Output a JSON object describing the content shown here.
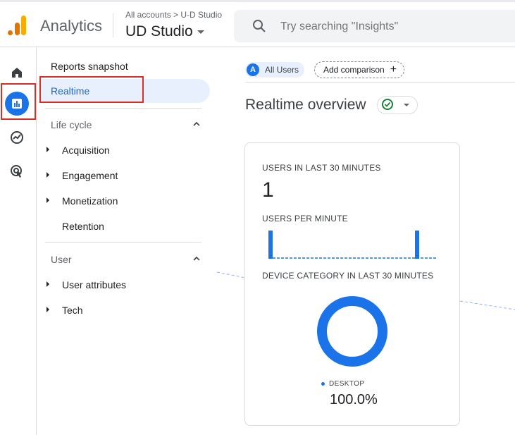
{
  "header": {
    "app_name": "Analytics",
    "breadcrumb": "All accounts > U-D Studio",
    "property_name": "UD Studio",
    "search_placeholder": "Try searching \"Insights\""
  },
  "rail": {
    "icons": [
      "home-icon",
      "reports-icon",
      "explore-icon",
      "advertising-icon"
    ],
    "active": "reports-icon"
  },
  "nav": {
    "reports_snapshot": "Reports snapshot",
    "realtime": "Realtime",
    "lifecycle": {
      "label": "Life cycle",
      "items": [
        "Acquisition",
        "Engagement",
        "Monetization",
        "Retention"
      ]
    },
    "user": {
      "label": "User",
      "items": [
        "User attributes",
        "Tech"
      ]
    }
  },
  "main": {
    "comparison_chip": {
      "avatar": "A",
      "label": "All Users"
    },
    "add_comparison": "Add comparison",
    "title": "Realtime overview",
    "card": {
      "users_30_label": "USERS IN LAST 30 MINUTES",
      "users_30_value": "1",
      "upm_label": "USERS PER MINUTE",
      "device_label": "DEVICE CATEGORY IN LAST 30 MINUTES",
      "device_legend": "DESKTOP",
      "device_percent": "100.0%"
    }
  },
  "colors": {
    "accent": "#1a73e8",
    "highlight": "#d93025",
    "active_bg": "#e8f0fe",
    "status_ok": "#188038"
  }
}
